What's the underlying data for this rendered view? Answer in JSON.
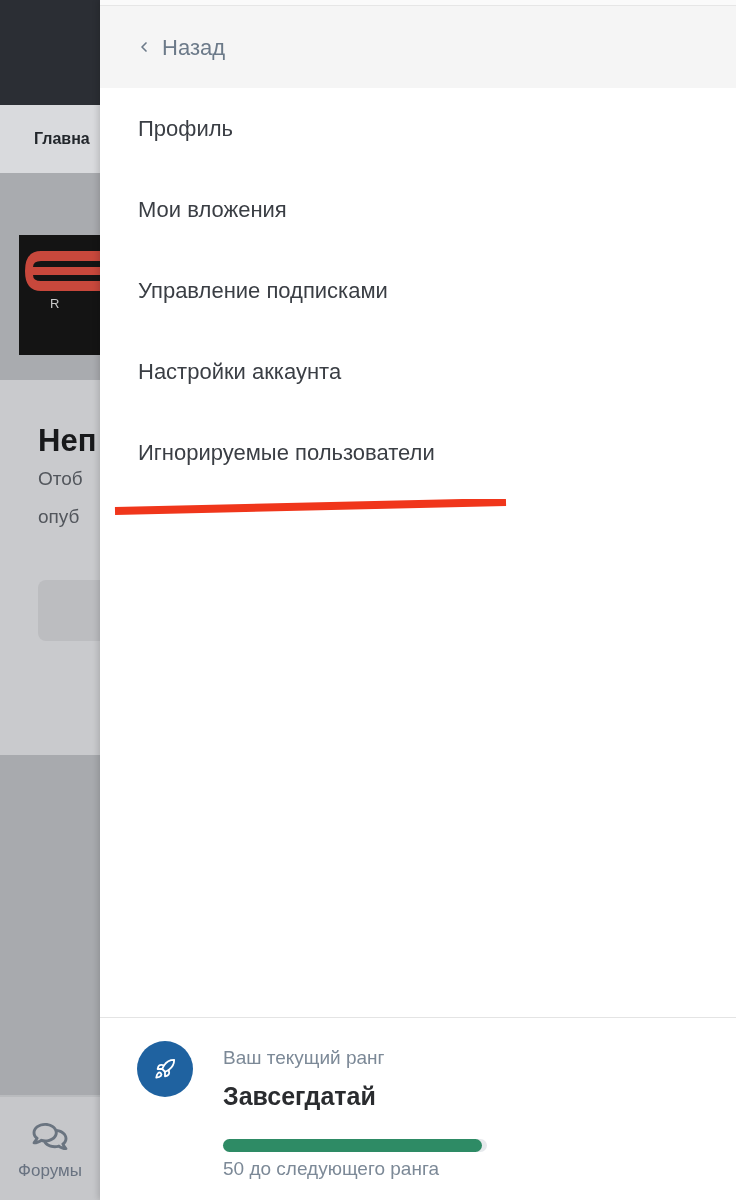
{
  "background_page": {
    "nav_tab": "Главна",
    "logo_letter": "R",
    "heading": "Неп",
    "description_lines": [
      "Отоб",
      "опуб"
    ],
    "bottom_nav": [
      {
        "label": "Форумы"
      }
    ]
  },
  "drawer": {
    "back_label": "Назад",
    "menu_items": [
      {
        "label": "Профиль"
      },
      {
        "label": "Мои вложения"
      },
      {
        "label": "Управление подписками"
      },
      {
        "label": "Настройки аккаунта"
      },
      {
        "label": "Игнорируемые пользователи"
      }
    ],
    "rank": {
      "caption": "Ваш текущий ранг",
      "name": "Завсегдатай",
      "level": 0.98,
      "progress_text": "50 до следующего ранга"
    }
  }
}
